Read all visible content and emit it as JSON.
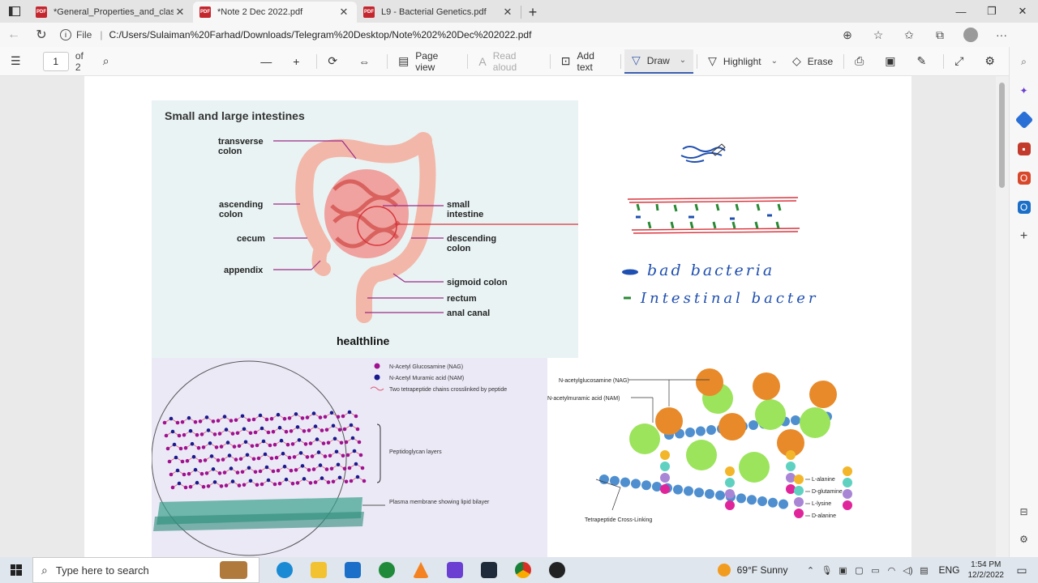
{
  "tabs": [
    {
      "label": "*General_Properties_and_classific",
      "active": false
    },
    {
      "label": "*Note 2 Dec 2022.pdf",
      "active": true
    },
    {
      "label": "L9 - Bacterial Genetics.pdf",
      "active": false
    }
  ],
  "address": {
    "scheme_label": "File",
    "url": "C:/Users/Sulaiman%20Farhad/Downloads/Telegram%20Desktop/Note%202%20Dec%202022.pdf"
  },
  "pdf_toolbar": {
    "page_current": "1",
    "page_total": "of 2",
    "page_view": "Page view",
    "read_aloud": "Read aloud",
    "add_text": "Add text",
    "draw": "Draw",
    "highlight": "Highlight",
    "erase": "Erase"
  },
  "figure_intestines": {
    "title": "Small and large intestines",
    "labels": {
      "transverse": "transverse\ncolon",
      "ascending": "ascending\ncolon",
      "cecum": "cecum",
      "appendix": "appendix",
      "small": "small\nintestine",
      "descending": "descending\ncolon",
      "sigmoid": "sigmoid colon",
      "rectum": "rectum",
      "anal": "anal canal"
    },
    "brand": "healthline"
  },
  "handwriting": {
    "line1": "bad bacteria",
    "line2": "Intestinal bacter"
  },
  "figure_peptidoglycan": {
    "legend": [
      {
        "label": "N-Acetyl Glucosamine (NAG)",
        "color": "#a0108f"
      },
      {
        "label": "N-Acetyl Muramic acid (NAM)",
        "color": "#1a1a8f"
      },
      {
        "label": "Two tetrapeptide chains crosslinked by peptide",
        "color": "#e0607a"
      }
    ],
    "layers_label": "Peptidoglycan layers",
    "membrane_label": "Plasma membrane showing lipid bilayer"
  },
  "figure_crosslink": {
    "nag_label": "N-acetylglucosamine (NAG)",
    "nam_label": "N-acetylmuramic acid (NAM)",
    "aa": [
      {
        "label": "L-alanine",
        "color": "#f3b62a"
      },
      {
        "label": "D-glutamine",
        "color": "#5fd1c1"
      },
      {
        "label": "L-lysine",
        "color": "#a985d6"
      },
      {
        "label": "D-alanine",
        "color": "#e0259a"
      }
    ],
    "crosslink_label": "Tetrapeptide Cross-Linking"
  },
  "taskbar": {
    "search_placeholder": "Type here to search",
    "weather": "69°F  Sunny",
    "lang": "ENG",
    "time": "1:54 PM",
    "date": "12/2/2022"
  }
}
